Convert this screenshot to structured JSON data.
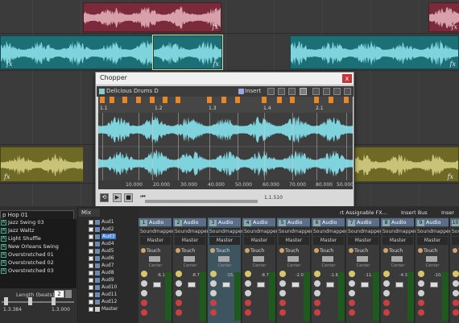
{
  "tracks": {
    "clips": [
      {
        "lane": 0,
        "color": "red",
        "fx": "fx"
      },
      {
        "lane": 0,
        "color": "red",
        "fx": "fx"
      },
      {
        "lane": 1,
        "color": "teal",
        "fx": "fx"
      },
      {
        "lane": 1,
        "color": "teal",
        "fx": "fx"
      },
      {
        "lane": 1,
        "color": "teal",
        "fx": "fx"
      },
      {
        "lane": 3,
        "color": "olive",
        "fx": "fx"
      },
      {
        "lane": 3,
        "color": "olive",
        "fx": "fx"
      }
    ],
    "fx_label": "fx"
  },
  "chopper": {
    "title": "Chopper",
    "close_label": "x",
    "clip_name": "Delicious Drums D",
    "insert_label": "Insert",
    "bar_labels": [
      "1.1",
      "1.2",
      "1.3",
      "1.4",
      "2.1"
    ],
    "scale_labels": [
      "10.000",
      "20.000",
      "30.000",
      "40.000",
      "50.000",
      "60.000",
      "70.000",
      "80.000",
      "90.000"
    ],
    "scale_end": "50.000",
    "position": "1.1.510",
    "transport": {
      "loop": "⟲",
      "play": "▶",
      "stop": "■",
      "rewind": "⏮"
    }
  },
  "loops": {
    "header": "p Hop 01",
    "items": [
      "Jazz Swing 03",
      "Jazz Waltz",
      "Light Shuffle",
      "New Orleans Swing",
      "Overstretched 01",
      "Overstretched 02",
      "Overstretched 03"
    ],
    "length_label": "Length (beats):",
    "length_value": "2",
    "slider_values": [
      "1.3.384",
      "1.3.000"
    ]
  },
  "mixer": {
    "tab_label": "Mix",
    "tracks": [
      "Aud1",
      "Aud2",
      "Aud3",
      "Aud4",
      "Aud5",
      "Aud6",
      "Aud7",
      "Aud8",
      "Aud9",
      "Aud10",
      "Aud11",
      "Aud12",
      "Master"
    ],
    "selected_track": "Aud3",
    "toolbar": {
      "assignable": "rt Assignable FX...",
      "insert_bus": "Insert Bus",
      "insert_s": "Inser"
    },
    "strips": [
      {
        "num": "1",
        "name": "Audio",
        "input": "Soundmapper",
        "output": "Master",
        "auto": "Touch",
        "pan": "Center",
        "db": "-6.1"
      },
      {
        "num": "2",
        "name": "Audio",
        "input": "Soundmapper",
        "output": "Master",
        "auto": "Touch",
        "pan": "Center",
        "db": "-8.7"
      },
      {
        "num": "3",
        "name": "Audio",
        "input": "Soundmapper",
        "output": "Master",
        "auto": "Touch",
        "pan": "Center",
        "db": "-15.4"
      },
      {
        "num": "4",
        "name": "Audio",
        "input": "Soundmapper",
        "output": "Master",
        "auto": "Touch",
        "pan": "Center",
        "db": "-8.7"
      },
      {
        "num": "5",
        "name": "Audio",
        "input": "Soundmapper",
        "output": "Master",
        "auto": "Touch",
        "pan": "Center",
        "db": "-2.0"
      },
      {
        "num": "6",
        "name": "Audio",
        "input": "Soundmapper",
        "output": "Master",
        "auto": "Touch",
        "pan": "Center",
        "db": "-1.6"
      },
      {
        "num": "7",
        "name": "Audio",
        "input": "Soundmapper",
        "output": "Master",
        "auto": "Touch",
        "pan": "Center",
        "db": "-11.2"
      },
      {
        "num": "8",
        "name": "Audio",
        "input": "Soundmapper",
        "output": "Master",
        "auto": "Touch",
        "pan": "Center",
        "db": "-4.3"
      },
      {
        "num": "9",
        "name": "Audio",
        "input": "Soundmapper",
        "output": "Master",
        "auto": "Touch",
        "pan": "Center",
        "db": "-10.3"
      },
      {
        "num": "10",
        "name": "Audio",
        "input": "Soundmapper",
        "output": "Master",
        "auto": "Touch",
        "pan": "Center",
        "db": "-10.0"
      }
    ]
  },
  "colors": {
    "red_clip": "#7a2a3a",
    "teal_clip": "#1d6f76",
    "olive_clip": "#6e6a26",
    "wave_teal": "#7fd3dd",
    "marker": "#e8872a"
  }
}
